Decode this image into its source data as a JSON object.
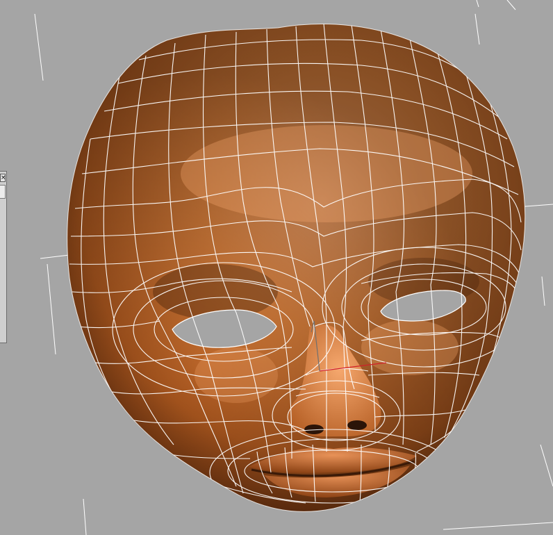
{
  "viewport": {
    "background": "#a5a5a5",
    "mesh_color": "#b9612a",
    "wire_color": "#ffffff",
    "axis_x_color": "#d0202a",
    "axis_y_color": "#6f6f6f"
  },
  "panel": {
    "close_glyph": "×"
  }
}
